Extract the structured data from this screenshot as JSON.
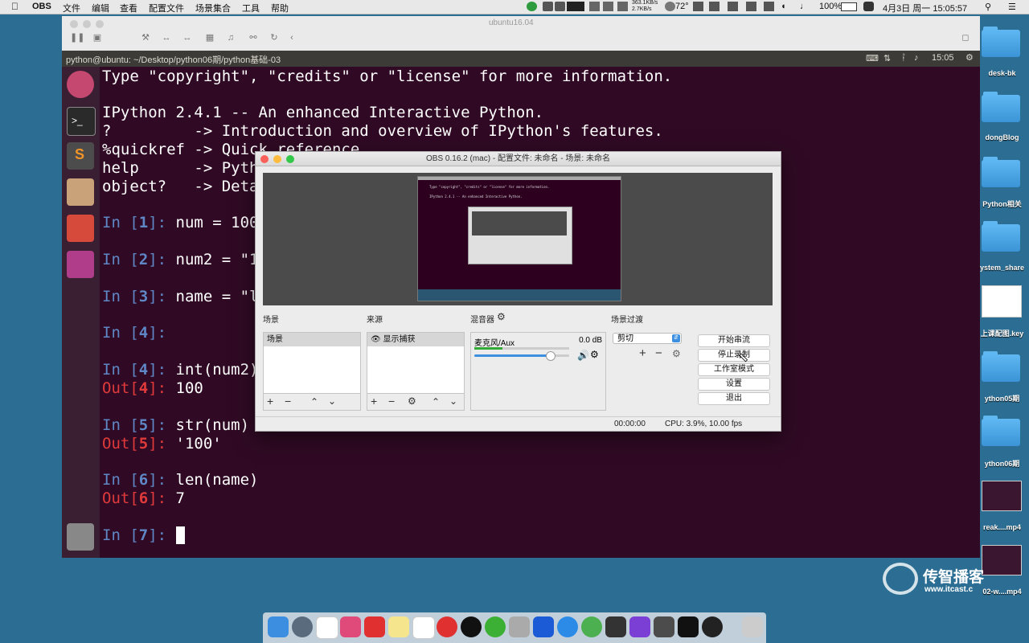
{
  "menubar": {
    "apple": "",
    "app": "OBS",
    "items": [
      "文件",
      "编辑",
      "查看",
      "配置文件",
      "场景集合",
      "工具",
      "帮助"
    ],
    "net_up": "363.1KB/s",
    "net_down": "2.7KB/s",
    "temp": "72°",
    "battery": "100%",
    "datetime": "4月3日 周一  15:05:57"
  },
  "desktop": {
    "items": [
      "desk-bk",
      "dongBlog",
      "Python相关",
      "ystem_share",
      "上课配图.key",
      "ython05期",
      "ython06期",
      "reak....mp4",
      "02-w....mp4"
    ]
  },
  "watermark": {
    "brand": "传智播客",
    "url": "www.itcast.c"
  },
  "vm": {
    "title": "ubuntu16.04",
    "terminal_title": "python@ubuntu: ~/Desktop/python06期/python基础-03",
    "time": "15:05"
  },
  "terminal": {
    "line1": "Type \"copyright\", \"credits\" or \"license\" for more information.",
    "line2": "IPython 2.4.1 -- An enhanced Interactive Python.",
    "line3": "?         -> Introduction and overview of IPython's features.",
    "line4": "%quickref -> Quick reference.",
    "line5": "help      -> Pyth",
    "line6": "object?   -> Deta",
    "in_label": "In [",
    "out_label": "Out[",
    "close": "]: ",
    "n1": "1",
    "c1": "num = 100",
    "n2": "2",
    "c2": "num2 = \"1",
    "n3": "3",
    "c3": "name = \"l",
    "n4": "4",
    "c4": "",
    "n5": "4",
    "c5": "int(num2)",
    "o5": "100",
    "n6": "5",
    "c6": "str(num)",
    "o6": "'100'",
    "n7": "6",
    "c7": "len(name)",
    "o7": "7",
    "n8": "7"
  },
  "obs": {
    "title": "OBS 0.16.2 (mac) - 配置文件: 未命名 - 场景: 未命名",
    "scenes_title": "场景",
    "sources_title": "来源",
    "mixer_title": "混音器",
    "transition_title": "场景过渡",
    "scene_item": "场景",
    "source_item": "显示捕获",
    "mixer_channel": "麦克风/Aux",
    "mixer_db": "0.0 dB",
    "mixer_level": 0.8,
    "transition_value": "剪切",
    "btn_stream": "开始串流",
    "btn_record": "停止录制",
    "btn_studio": "工作室模式",
    "btn_settings": "设置",
    "btn_exit": "退出",
    "status_time": "00:00:00",
    "status_cpu": "CPU: 3.9%, 10.00 fps"
  },
  "preview": {
    "line1": "Type \"copyright\", \"credits\" or \"license\" for more information.",
    "line2": "IPython 2.4.1 -- An enhanced Interactive Python."
  },
  "colors": {
    "terminal_bg": "#300a24",
    "prompt_in": "#5f87c6",
    "prompt_out": "#e03a3a",
    "desktop": "#2c6e93"
  }
}
